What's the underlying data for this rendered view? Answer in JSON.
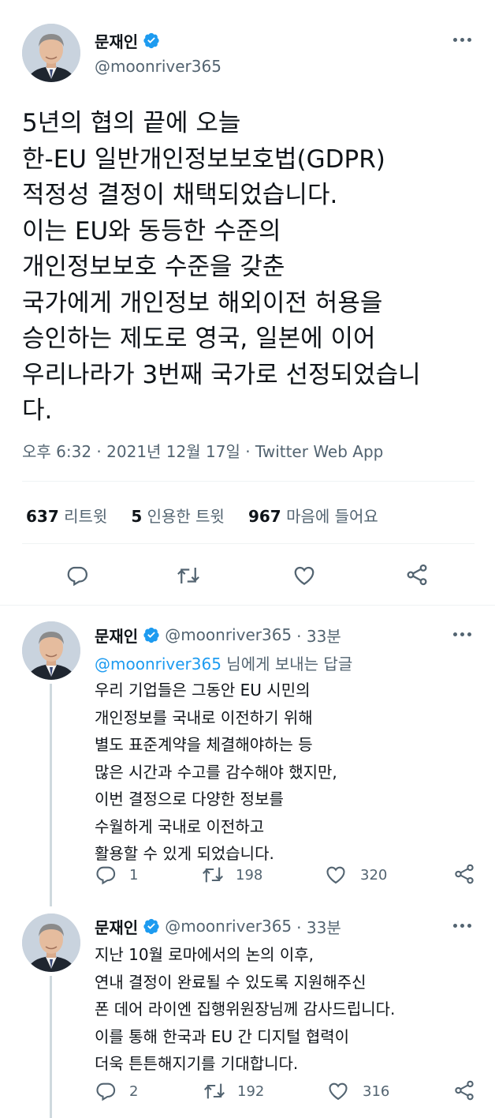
{
  "main": {
    "author_name": "문재인",
    "author_handle": "@moonriver365",
    "text": "5년의 협의 끝에 오늘\n한-EU 일반개인정보보호법(GDPR)\n적정성 결정이 채택되었습니다.\n이는 EU와 동등한 수준의\n개인정보보호 수준을 갖춘\n국가에게 개인정보 해외이전 허용을\n승인하는 제도로 영국, 일본에 이어\n우리나라가 3번째 국가로 선정되었습니\n다.",
    "timestamp": "오후 6:32 · 2021년 12월 17일 · Twitter Web App",
    "stats": {
      "retweets_count": "637",
      "retweets_label": "리트윗",
      "quotes_count": "5",
      "quotes_label": "인용한 트윗",
      "likes_count": "967",
      "likes_label": "마음에 들어요"
    },
    "actions": [
      "reply-icon",
      "retweet-icon",
      "like-icon",
      "share-icon"
    ]
  },
  "replies": [
    {
      "author_name": "문재인",
      "author_handle": "@moonriver365",
      "time": "· 33분",
      "replying_to_handle": "@moonriver365",
      "replying_to_suffix": " 님에게 보내는 답글",
      "text": "우리 기업들은 그동안 EU 시민의\n개인정보를 국내로 이전하기 위해\n별도 표준계약을 체결해야하는 등\n많은 시간과 수고를 감수해야 했지만,\n이번 결정으로 다양한 정보를\n수월하게 국내로 이전하고\n활용할 수 있게 되었습니다.",
      "reply_count": "1",
      "retweet_count": "198",
      "like_count": "320"
    },
    {
      "author_name": "문재인",
      "author_handle": "@moonriver365",
      "time": "· 33분",
      "text": "지난 10월 로마에서의 논의 이후,\n연내 결정이 완료될 수 있도록 지원해주신\n폰 데어 라이엔 집행위원장님께 감사드립니다.\n이를 통해 한국과 EU 간 디지털 협력이\n더욱 튼튼해지기를 기대합니다.",
      "reply_count": "2",
      "retweet_count": "192",
      "like_count": "316"
    }
  ],
  "colors": {
    "text": "#0f1419",
    "secondary": "#536471",
    "accent": "#1d9bf0",
    "divider": "#eff3f4"
  }
}
